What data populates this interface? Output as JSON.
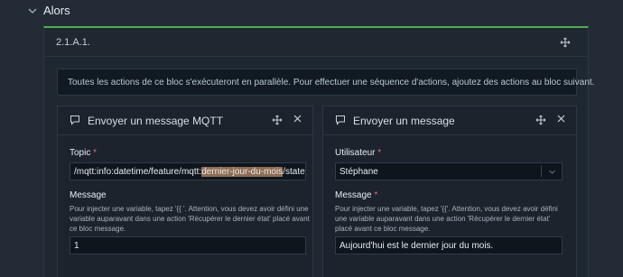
{
  "section": {
    "title": "Alors"
  },
  "block": {
    "title": "2.1.A.1.",
    "info": "Toutes les actions de ce bloc s'exécuteront en parallèle. Pour effectuer une séquence d'actions, ajoutez des actions au bloc suivant."
  },
  "mqtt_card": {
    "title": "Envoyer un message MQTT",
    "topic_label": "Topic",
    "topic_prefix": "/mqtt:info:datetime/feature/mqtt:",
    "topic_highlight": "dernier-jour-du-mois",
    "topic_suffix": "/state",
    "message_label": "Message",
    "message_help_1": "Pour injecter une variable, tapez '{{ '. Attention, vous devez avoir défini une",
    "message_help_2": "variable auparavant dans une action 'Récupérer le dernier état' placé avant",
    "message_help_3": "ce bloc message.",
    "message_value": "1"
  },
  "message_card": {
    "title": "Envoyer un message",
    "user_label": "Utilisateur",
    "user_value": "Stéphane",
    "message_label": "Message",
    "message_help_1": "Pour injecter une variable, tapez '{{'. Attention, vous devez avoir défini",
    "message_help_2": "une variable auparavant dans une action 'Récupérer le dernier état'",
    "message_help_3": "placé avant ce bloc message.",
    "message_value": "Aujourd'hui est le dernier jour du mois."
  },
  "required_mark": "*",
  "icons": {
    "section_toggle": "chevron-down-icon",
    "move": "move-arrows-icon",
    "message": "message-bubble-icon",
    "close": "close-icon",
    "select": "chevron-down-icon"
  },
  "colors": {
    "accent": "#4caf50",
    "highlight": "#8c6d57",
    "required": "#e06c75"
  }
}
